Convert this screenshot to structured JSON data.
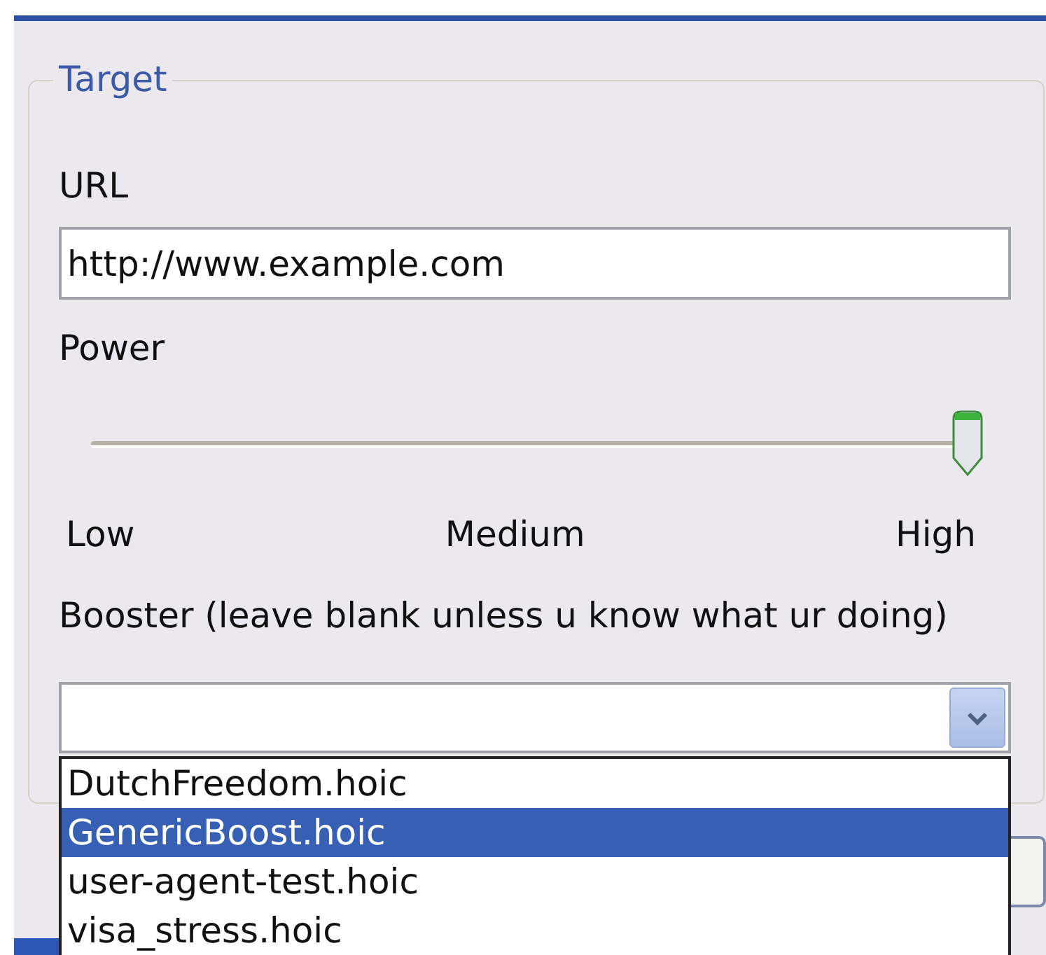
{
  "group": {
    "title": "Target"
  },
  "url": {
    "label": "URL",
    "value": "http://www.example.com"
  },
  "power": {
    "label": "Power",
    "level": 1,
    "ticks": [
      "Low",
      "Medium",
      "High"
    ]
  },
  "booster": {
    "label": "Booster (leave blank unless u know what ur doing)",
    "expanded": true,
    "options": [
      {
        "label": "DutchFreedom.hoic",
        "selected": false
      },
      {
        "label": "GenericBoost.hoic",
        "selected": true
      },
      {
        "label": "user-agent-test.hoic",
        "selected": false
      },
      {
        "label": "visa_stress.hoic",
        "selected": false
      }
    ]
  }
}
